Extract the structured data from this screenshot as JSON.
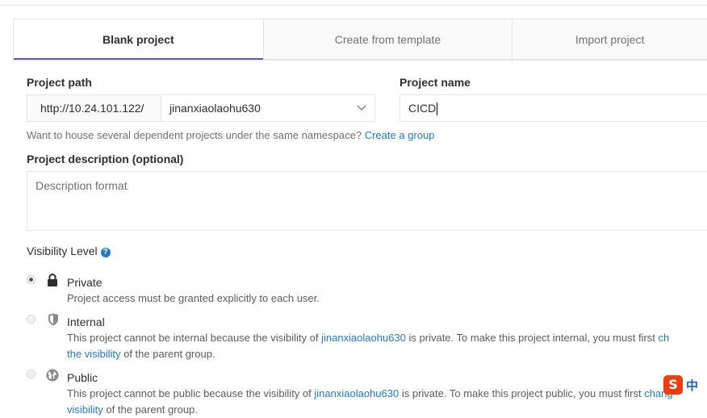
{
  "tabs": [
    {
      "label": "Blank project",
      "active": true
    },
    {
      "label": "Create from template",
      "active": false
    },
    {
      "label": "Import project",
      "active": false
    }
  ],
  "form": {
    "project_path_label": "Project path",
    "path_prefix": "http://10.24.101.122/",
    "namespace_value": "jinanxiaolaohu630",
    "project_name_label": "Project name",
    "project_name_value": "CICD",
    "help_text": "Want to house several dependent projects under the same namespace?",
    "help_link": "Create a group",
    "description_label": "Project description (optional)",
    "description_placeholder": "Description format",
    "visibility_label": "Visibility Level",
    "visibility_help_icon": "question-circle-icon"
  },
  "visibility": {
    "private": {
      "title": "Private",
      "icon": "lock-icon",
      "selected": true,
      "desc": "Project access must be granted explicitly to each user."
    },
    "internal": {
      "title": "Internal",
      "icon": "shield-icon",
      "selected": false,
      "desc_pre": "This project cannot be internal because the visibility of",
      "desc_link": "jinanxiaolaohu630",
      "desc_mid": "is private. To make this project internal, you must first",
      "desc_link2": "ch",
      "line2_link": "the visibility",
      "line2_rest": "of the parent group."
    },
    "public": {
      "title": "Public",
      "icon": "globe-icon",
      "selected": false,
      "desc_pre": "This project cannot be public because the visibility of",
      "desc_link": "jinanxiaolaohu630",
      "desc_mid": "is private. To make this project public, you must first",
      "desc_link2": "chang",
      "line2_link": "visibility",
      "line2_rest": "of the parent group."
    }
  },
  "ime": {
    "logo": "S",
    "mode": "中"
  },
  "colors": {
    "accent": "#6b4fbb",
    "link": "#1f78d1",
    "ime": "#ee3d11"
  }
}
